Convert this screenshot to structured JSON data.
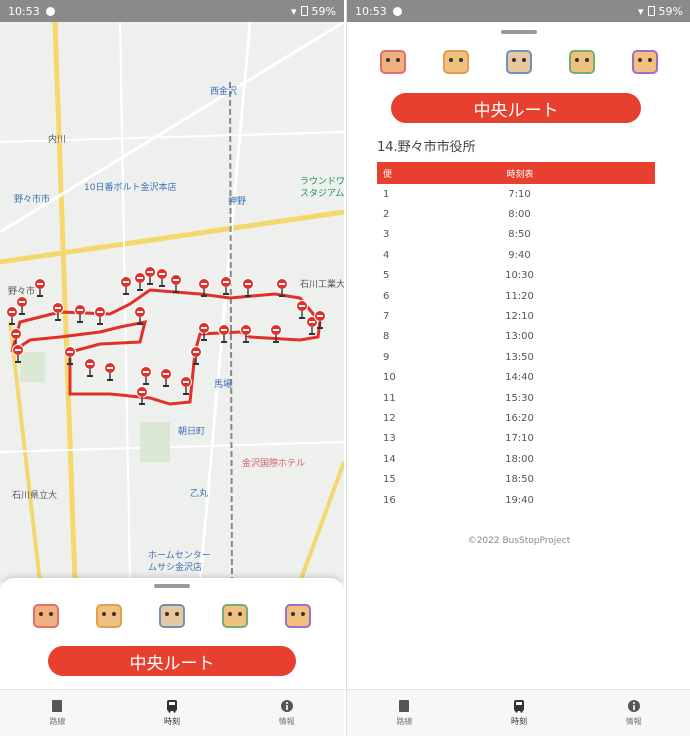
{
  "left": {
    "status": {
      "time": "10:53",
      "battery": "59%"
    },
    "map_labels": {
      "nonoichi_city": "野々市市",
      "hakusan": "西金沢",
      "nonoichi": "押野",
      "uchikawa": "内川",
      "place1": "10日番ボルト金沢本店",
      "place2": "ラウンドワン",
      "place3": "スタジアム",
      "daigaku": "石川県立大",
      "kanazawa_hotel": "金沢国際ホテル",
      "baba": "馬場",
      "asahi": "朝日町",
      "otome": "乙丸",
      "home_center": "ホームセンター",
      "home_center2": "ムサシ金沢店",
      "tomioka": "野々市",
      "kougyo": "石川工業大"
    },
    "sheet": {
      "route_label": "中央ルート"
    },
    "nav": [
      {
        "label": "路線"
      },
      {
        "label": "時刻"
      },
      {
        "label": "情報"
      }
    ]
  },
  "right": {
    "status": {
      "time": "10:53",
      "battery": "59%"
    },
    "route_label": "中央ルート",
    "stop_name": "14.野々市市役所",
    "table": {
      "headers": [
        "便",
        "時刻表"
      ],
      "rows": [
        {
          "n": "1",
          "t": "7:10"
        },
        {
          "n": "2",
          "t": "8:00"
        },
        {
          "n": "3",
          "t": "8:50"
        },
        {
          "n": "4",
          "t": "9:40"
        },
        {
          "n": "5",
          "t": "10:30"
        },
        {
          "n": "6",
          "t": "11:20"
        },
        {
          "n": "7",
          "t": "12:10"
        },
        {
          "n": "8",
          "t": "13:00"
        },
        {
          "n": "9",
          "t": "13:50"
        },
        {
          "n": "10",
          "t": "14:40"
        },
        {
          "n": "11",
          "t": "15:30"
        },
        {
          "n": "12",
          "t": "16:20"
        },
        {
          "n": "13",
          "t": "17:10"
        },
        {
          "n": "14",
          "t": "18:00"
        },
        {
          "n": "15",
          "t": "18:50"
        },
        {
          "n": "16",
          "t": "19:40"
        }
      ]
    },
    "copyright": "©2022 BusStopProject",
    "nav": [
      {
        "label": "路線"
      },
      {
        "label": "時刻"
      },
      {
        "label": "情報"
      }
    ]
  },
  "colors": {
    "accent": "#e8402f",
    "route": "#e0302a",
    "road_yellow": "#f5d76e",
    "char_colors": [
      "#e07070",
      "#e0a050",
      "#7090c0",
      "#70b070",
      "#a070c0"
    ]
  }
}
